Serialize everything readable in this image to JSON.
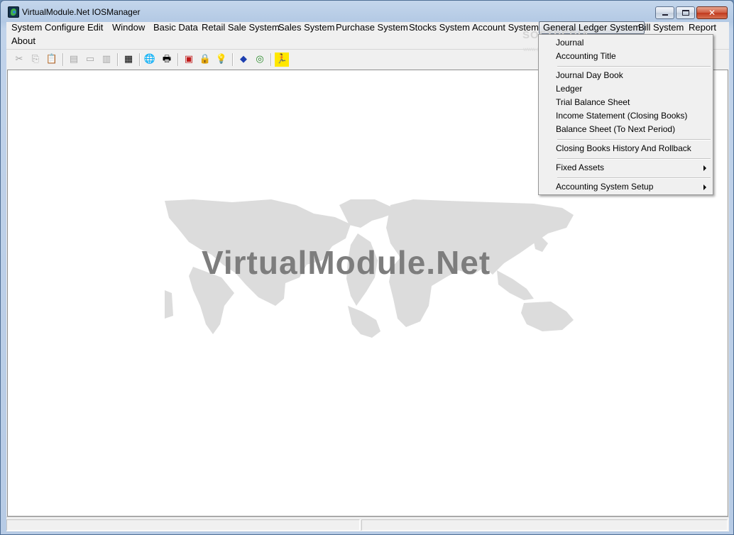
{
  "window": {
    "title": "VirtualModule.Net IOSManager",
    "caption_buttons": {
      "minimize": "minimize",
      "maximize": "restore",
      "close": "✕"
    }
  },
  "menubar": {
    "items": [
      "System Configure",
      "Edit",
      "Window",
      "Basic Data",
      "Retail Sale System",
      "Sales System",
      "Purchase System",
      "Stocks System",
      "Account System",
      "General Ledger System",
      "Bill System",
      "Report",
      "About"
    ],
    "active_item": "General Ledger System"
  },
  "toolbar": {
    "icons": {
      "cut": "✂",
      "copy": "⎘",
      "paste": "📋",
      "cascade": "▤",
      "tile_horizontal": "▭",
      "tile_vertical": "▥",
      "calculator": "▦",
      "internet": "🌐",
      "print": "🖶",
      "color_palette": "▣",
      "lock": "🔒",
      "tip": "💡",
      "book": "◆",
      "cd": "◎",
      "exit": "🏃"
    }
  },
  "workspace": {
    "watermark": "VirtualModule.Net"
  },
  "overlay_watermark": {
    "text": "SOFTPEDIA",
    "subtext": "www.softpedia.com"
  },
  "dropdown": {
    "items": [
      {
        "label": "Journal"
      },
      {
        "label": "Accounting Title"
      },
      {
        "label": "Journal Day Book"
      },
      {
        "label": "Ledger"
      },
      {
        "label": "Trial Balance Sheet"
      },
      {
        "label": "Income Statement (Closing Books)"
      },
      {
        "label": "Balance Sheet (To Next Period)"
      },
      {
        "label": "Closing Books History And Rollback"
      },
      {
        "label": "Fixed Assets",
        "submenu": true
      },
      {
        "label": "Accounting System Setup",
        "submenu": true
      }
    ]
  },
  "colors": {
    "title_gradient_top": "#c4d6ec",
    "close_button": "#c0391d",
    "map_gray": "#dcdcdc",
    "watermark_text": "#7d7d7d"
  }
}
